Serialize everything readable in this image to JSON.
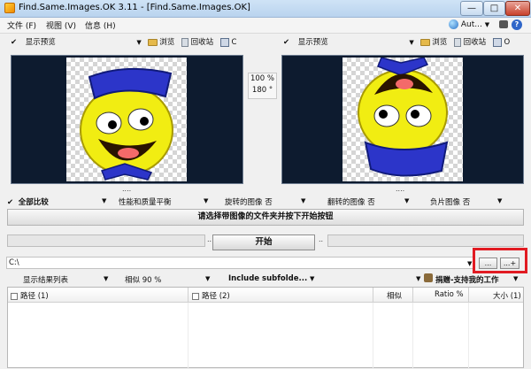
{
  "window": {
    "title": "Find.Same.Images.OK 3.11 - [Find.Same.Images.OK]",
    "minimize": "—",
    "maximize": "□",
    "close": "✕"
  },
  "menu": {
    "file": "文件 (F)",
    "view": "视图 (V)",
    "info": "信息 (H)",
    "auto_label": "Aut...",
    "auto_arrow": "▼"
  },
  "toolbar_left": {
    "show_preview": "显示预览",
    "dropdown": "▼",
    "browse": "浏览",
    "recycle": "回收站",
    "copy": "C"
  },
  "toolbar_right": {
    "show_preview": "显示预览",
    "dropdown": "▼",
    "browse": "浏览",
    "recycle": "回收站",
    "copy": "O"
  },
  "preview": {
    "zoom": "100 %",
    "rotation": "180 °",
    "dots": "...."
  },
  "compare": {
    "all_compare": "全部比较",
    "performance": "性能和质量平衡",
    "rotated": "旋转的图像 否",
    "flipped": "翻转的图像 否",
    "negative": "负片图像 否",
    "dropdown": "▼"
  },
  "status": {
    "message": "请选择带图像的文件夹并按下开始按钮"
  },
  "actions": {
    "start": "开始",
    "progress_left_marker": "..",
    "progress_right_marker": ".."
  },
  "path": {
    "value": "C:\\",
    "dropdown": "▼",
    "browse_button": "...",
    "add_button": "...+"
  },
  "options": {
    "display": "显示结果列表",
    "similar": "相似 90 %",
    "include": "Include subfolde...",
    "donate": "捐赠-支持我的工作",
    "dropdown": "▼"
  },
  "table": {
    "columns": [
      "路径 (1)",
      "路径 (2)",
      "相似",
      "Ratio %",
      "大小 (1)"
    ]
  }
}
